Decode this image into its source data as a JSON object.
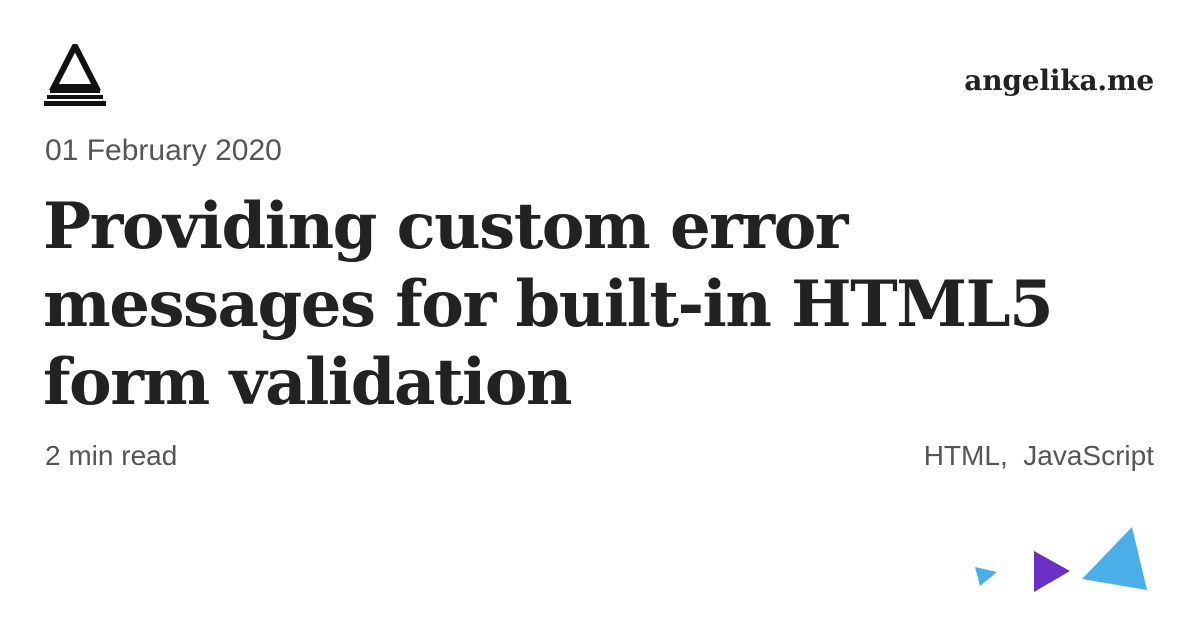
{
  "site": {
    "name": "angelika.me"
  },
  "post": {
    "date": "01 February 2020",
    "title": "Providing custom error messages for built-in HTML5 form validation",
    "reading_time": "2 min read",
    "tags": [
      "HTML",
      "JavaScript"
    ]
  },
  "logo": {
    "icon": "triangle-logo-icon",
    "color": "#111111"
  },
  "decoration": {
    "icon": "triangles-icon",
    "colors": {
      "small": "#4AAFE8",
      "purple": "#6A2FC5",
      "large": "#4AAFE8"
    }
  },
  "colors": {
    "text": "#222222",
    "muted": "#555555",
    "background": "#ffffff"
  }
}
